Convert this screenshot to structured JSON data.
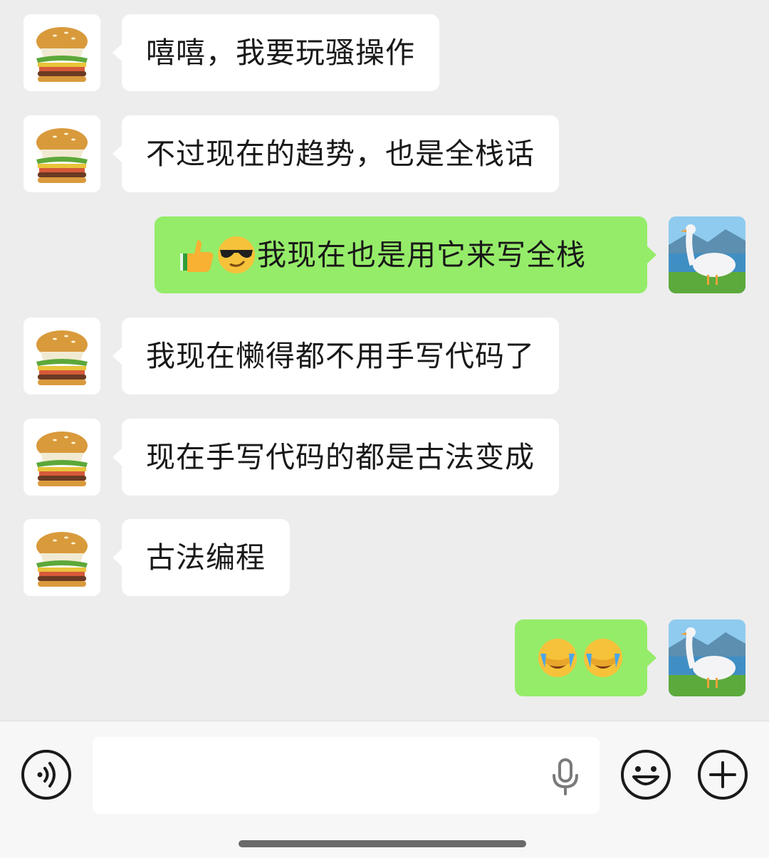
{
  "messages": [
    {
      "side": "left",
      "text": "嘻嘻，我要玩骚操作"
    },
    {
      "side": "left",
      "text": "不过现在的趋势，也是全栈话"
    },
    {
      "side": "right",
      "emoji": [
        "thumbs-up",
        "sunglasses-face"
      ],
      "text": "我现在也是用它来写全栈"
    },
    {
      "side": "left",
      "text": "我现在懒得都不用手写代码了"
    },
    {
      "side": "left",
      "text": "现在手写代码的都是古法变成"
    },
    {
      "side": "left",
      "text": "古法编程"
    },
    {
      "side": "right",
      "emoji": [
        "facepalm-crying-face",
        "facepalm-crying-face"
      ],
      "text": ""
    }
  ],
  "input_bar": {
    "voice_icon": "voice-toggle-icon",
    "mic_icon": "microphone-icon",
    "emoji_icon": "emoji-icon",
    "plus_icon": "plus-icon",
    "input_value": ""
  },
  "colors": {
    "background": "#ededed",
    "incoming_bubble": "#ffffff",
    "outgoing_bubble": "#95ec69",
    "text": "#191919"
  }
}
